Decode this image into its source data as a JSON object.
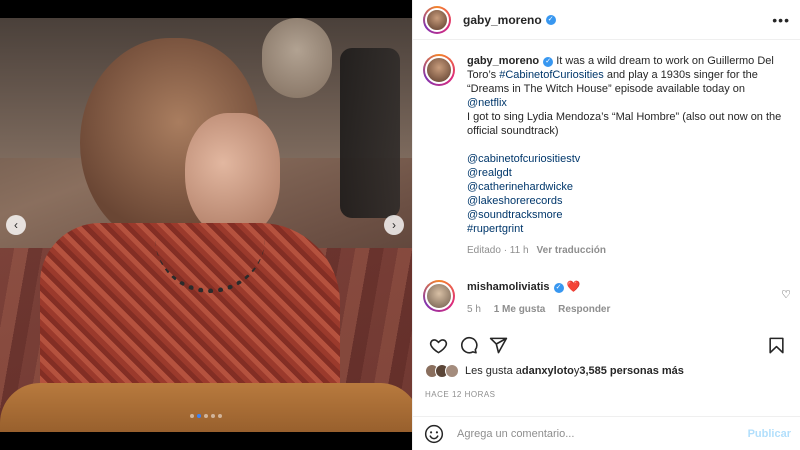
{
  "post": {
    "username": "gaby_moreno",
    "caption_before_tag": " It was a wild dream to work on Guillermo Del Toro’s ",
    "hashtag_1": "#CabinetofCuriosities",
    "caption_mid": " and play a 1930s singer for the “Dreams in The Witch House” episode available today on ",
    "mention_netflix": "@netflix",
    "caption_after": "I got to sing Lydia Mendoza’s “Mal Hombre” (also out now on the official soundtrack)",
    "tags": [
      "@cabinetofcuriositiestv",
      "@realgdt",
      "@catherinehardwicke",
      "@lakeshorerecords",
      "@soundtracksmore",
      "#rupertgrint"
    ],
    "edited": "Editado · 11 h",
    "see_translation": "Ver traducción"
  },
  "comment": {
    "username": "mishamoliviatis",
    "text": "❤️",
    "age": "5 h",
    "likes": "1 Me gusta",
    "reply": "Responder"
  },
  "likes": {
    "prefix": "Les gusta a ",
    "user": "danxyloto",
    "conj": " y ",
    "count": "3,585 personas más"
  },
  "time_ago": "HACE 12 HORAS",
  "composer": {
    "placeholder": "Agrega un comentario...",
    "publish": "Publicar"
  },
  "carousel": {
    "dots": 5,
    "active_index": 1
  },
  "icons": {
    "more": "more-options-icon",
    "like": "heart-icon",
    "comment": "comment-icon",
    "share": "share-icon",
    "save": "bookmark-icon",
    "emoji": "emoji-icon",
    "verified": "verified-badge-icon"
  },
  "colors": {
    "link": "#00376b",
    "verified": "#3897f0",
    "publish_disabled": "#b2dffc",
    "heart": "#ed4956"
  }
}
